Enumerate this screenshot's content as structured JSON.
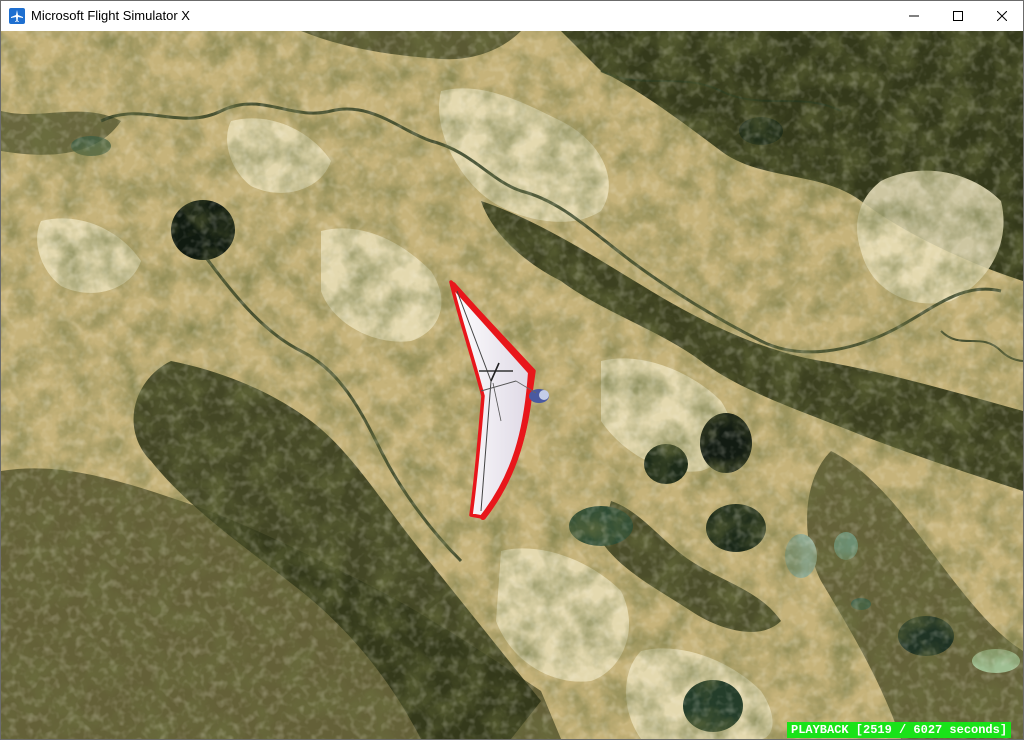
{
  "window": {
    "title": "Microsoft Flight Simulator X",
    "app_icon": "airplane-icon",
    "controls": {
      "minimize": "minimize-icon",
      "maximize": "maximize-icon",
      "close": "close-icon"
    }
  },
  "scene": {
    "view": "top-down aerial view over desert terrain with rivers and lakes",
    "aircraft": "hang-glider",
    "colors": {
      "wing_edge": "#e8161b",
      "wing_fill": "#f1eef2",
      "status_bg": "#19e319",
      "status_text": "#ffffff"
    }
  },
  "status": {
    "text": "PLAYBACK [2519 / 6027 seconds]",
    "mode": "PLAYBACK",
    "current_seconds": 2519,
    "total_seconds": 6027
  }
}
